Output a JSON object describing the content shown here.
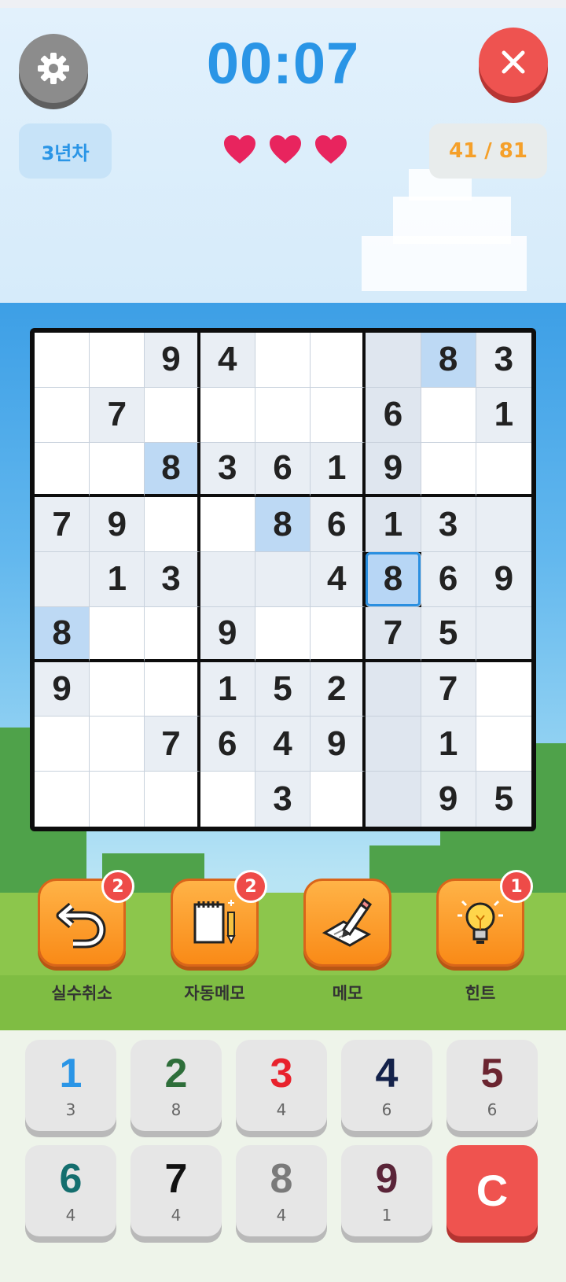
{
  "header": {
    "timer": "00:07",
    "level": "3년차",
    "progress": "41 / 81",
    "lives": 3
  },
  "board": {
    "rows": [
      [
        "",
        "",
        "9",
        "4",
        "",
        "",
        "",
        "8",
        "3"
      ],
      [
        "",
        "7",
        "",
        "",
        "",
        "",
        "6",
        "",
        "1"
      ],
      [
        "",
        "",
        "8",
        "3",
        "6",
        "1",
        "9",
        "",
        ""
      ],
      [
        "7",
        "9",
        "",
        "",
        "8",
        "6",
        "1",
        "3",
        ""
      ],
      [
        "",
        "1",
        "3",
        "",
        "",
        "4",
        "8",
        "6",
        "9"
      ],
      [
        "8",
        "",
        "",
        "9",
        "",
        "",
        "7",
        "5",
        ""
      ],
      [
        "9",
        "",
        "",
        "1",
        "5",
        "2",
        "",
        "7",
        ""
      ],
      [
        "",
        "",
        "7",
        "6",
        "4",
        "9",
        "",
        "1",
        ""
      ],
      [
        "",
        "",
        "",
        "",
        "3",
        "",
        "",
        "9",
        "5"
      ]
    ],
    "selected": {
      "row": 4,
      "col": 6
    }
  },
  "tools": [
    {
      "label": "실수취소",
      "badge": "2",
      "icon": "undo-icon"
    },
    {
      "label": "자동메모",
      "badge": "2",
      "icon": "auto-notes-icon"
    },
    {
      "label": "메모",
      "badge": "",
      "icon": "pencil-notes-icon"
    },
    {
      "label": "힌트",
      "badge": "1",
      "icon": "lightbulb-icon"
    }
  ],
  "keypad": [
    {
      "num": "1",
      "count": "3",
      "color": "#2a95e6"
    },
    {
      "num": "2",
      "count": "8",
      "color": "#2e6e3a"
    },
    {
      "num": "3",
      "count": "4",
      "color": "#e8222c"
    },
    {
      "num": "4",
      "count": "6",
      "color": "#14224a"
    },
    {
      "num": "5",
      "count": "6",
      "color": "#6b2530"
    },
    {
      "num": "6",
      "count": "4",
      "color": "#146e6e"
    },
    {
      "num": "7",
      "count": "4",
      "color": "#111111"
    },
    {
      "num": "8",
      "count": "4",
      "color": "#7a7a7a"
    },
    {
      "num": "9",
      "count": "1",
      "color": "#5a2438"
    },
    {
      "num": "C",
      "count": "",
      "color": "#ffffff"
    }
  ],
  "colors": {
    "accent": "#2a95e6",
    "heart": "#e8245e",
    "tool": "#f98a17",
    "danger": "#ee5350"
  }
}
